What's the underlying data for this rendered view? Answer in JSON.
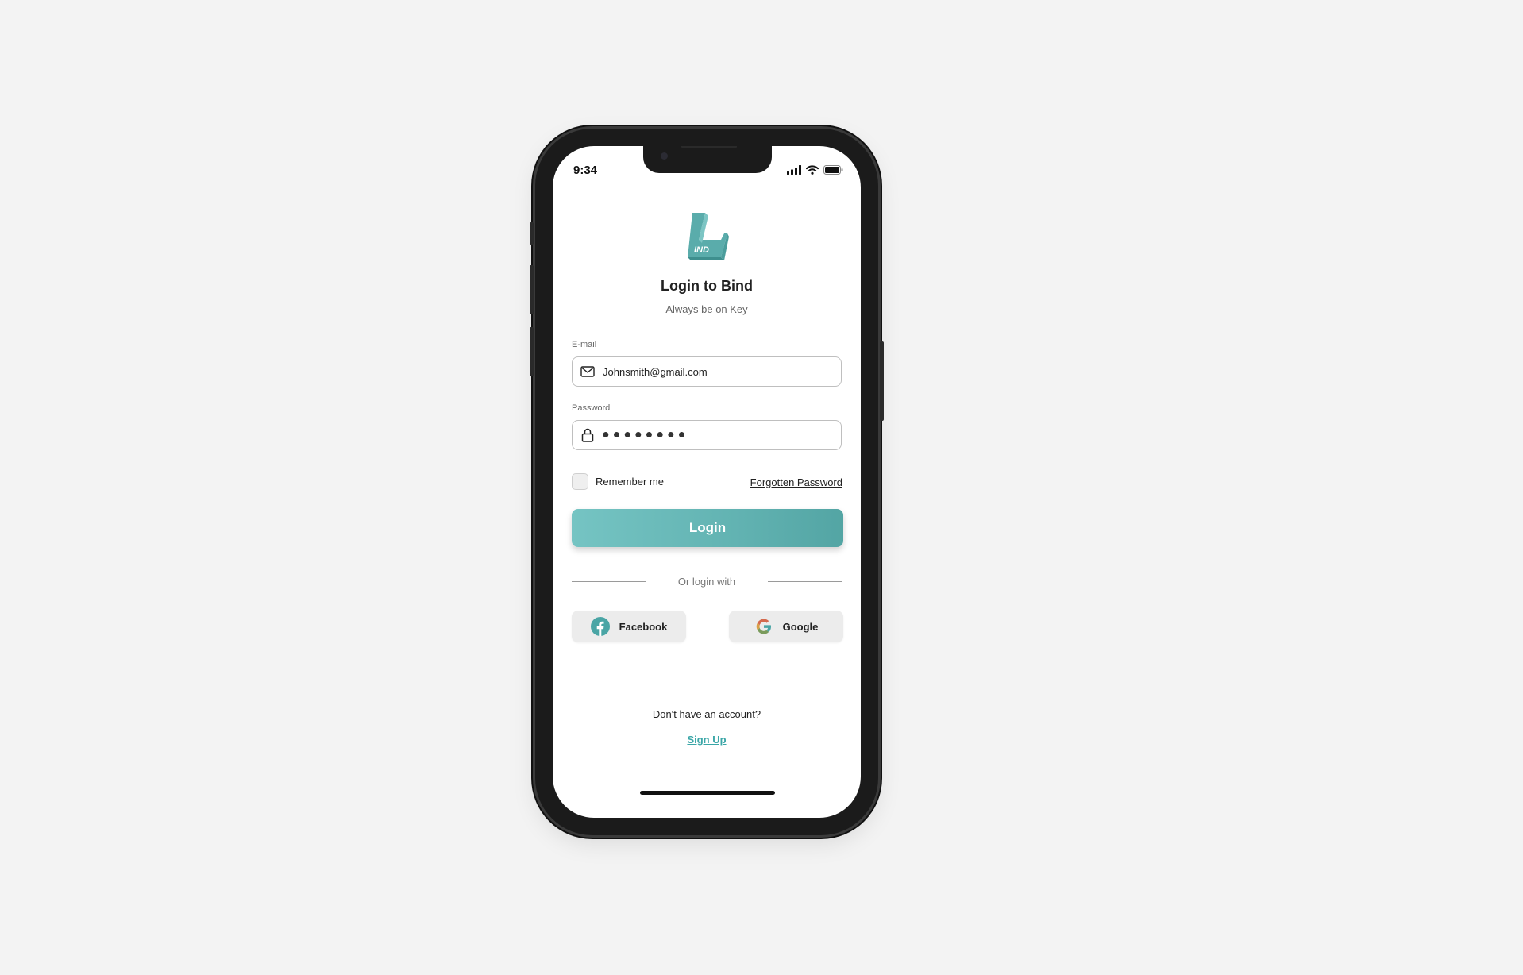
{
  "status_bar": {
    "time": "9:34",
    "icons": [
      "cellular-signal-icon",
      "wifi-icon",
      "battery-icon"
    ]
  },
  "logo": {
    "text": "IND",
    "color": "#5aacab"
  },
  "header": {
    "title": "Login to Bind",
    "subtitle": "Always be on Key"
  },
  "email": {
    "label": "E-mail",
    "value": "Johnsmith@gmail.com",
    "icon": "mail-icon"
  },
  "password": {
    "label": "Password",
    "masked_value": "●●●●●●●●",
    "icon": "lock-icon"
  },
  "remember": {
    "label": "Remember me",
    "checked": false
  },
  "forgot_password": {
    "label": "Forgotten Password"
  },
  "login_button": {
    "label": "Login"
  },
  "divider": {
    "label": "Or login with"
  },
  "social": {
    "facebook": {
      "label": "Facebook",
      "icon": "facebook-icon"
    },
    "google": {
      "label": "Google",
      "icon": "google-icon"
    }
  },
  "signup": {
    "prompt": "Don't have an account?",
    "link_label": "Sign Up"
  },
  "colors": {
    "accent": "#5aacab",
    "link": "#3aa6a7",
    "background": "#f3f3f3"
  }
}
